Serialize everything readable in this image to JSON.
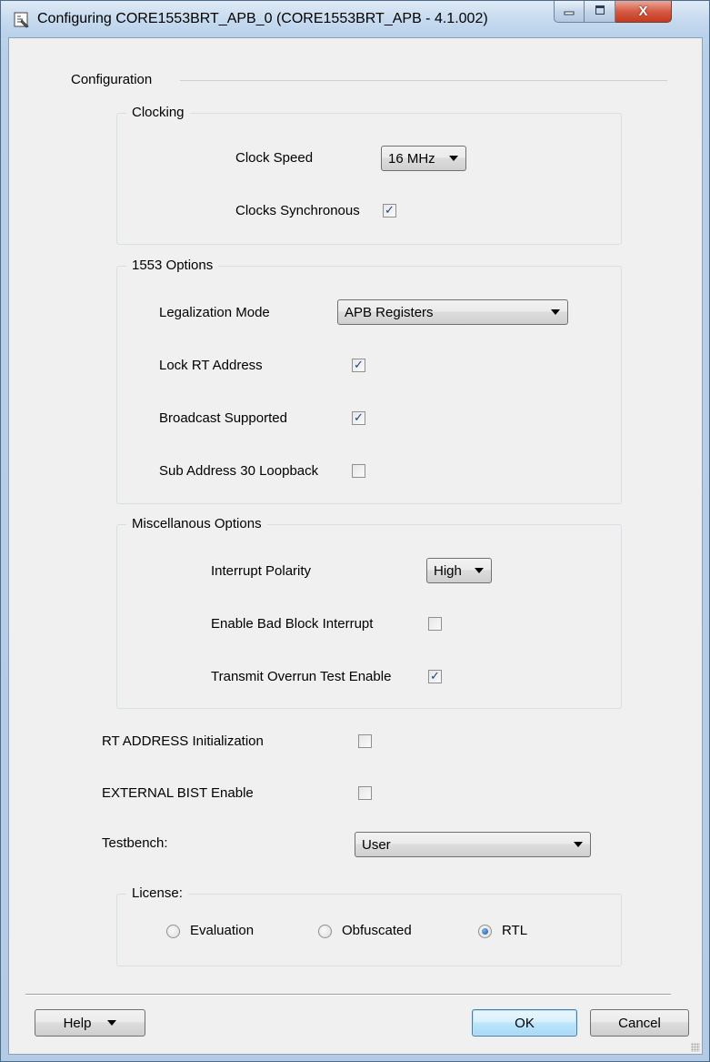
{
  "window": {
    "title": "Configuring CORE1553BRT_APB_0 (CORE1553BRT_APB - 4.1.002)",
    "close_glyph": "X",
    "icons": {
      "app": "config-app-icon",
      "minimize": "minimize-icon",
      "maximize": "maximize-icon",
      "close": "close-icon"
    },
    "accent_close_color": "#c33a1f"
  },
  "configuration": {
    "section_label": "Configuration",
    "clocking": {
      "label": "Clocking",
      "clock_speed_label": "Clock Speed",
      "clock_speed_value": "16 MHz",
      "clocks_synchronous_label": "Clocks Synchronous",
      "clocks_synchronous_checked": true
    },
    "options_1553": {
      "label": "1553 Options",
      "legalization_mode_label": "Legalization Mode",
      "legalization_mode_value": "APB Registers",
      "lock_rt_address_label": "Lock RT Address",
      "lock_rt_address_checked": true,
      "broadcast_supported_label": "Broadcast Supported",
      "broadcast_supported_checked": true,
      "sub_address_30_loopback_label": "Sub Address 30 Loopback",
      "sub_address_30_loopback_checked": false
    },
    "misc": {
      "label": "Miscellanous Options",
      "interrupt_polarity_label": "Interrupt Polarity",
      "interrupt_polarity_value": "High",
      "enable_bad_block_interrupt_label": "Enable Bad Block Interrupt",
      "enable_bad_block_interrupt_checked": false,
      "transmit_overrun_test_enable_label": "Transmit Overrun Test Enable",
      "transmit_overrun_test_enable_checked": true
    },
    "rt_address_initialization_label": "RT ADDRESS Initialization",
    "rt_address_initialization_checked": false,
    "external_bist_enable_label": "EXTERNAL BIST Enable",
    "external_bist_enable_checked": false,
    "testbench_label": "Testbench:",
    "testbench_value": "User",
    "license": {
      "label": "License:",
      "options": [
        "Evaluation",
        "Obfuscated",
        "RTL"
      ],
      "selected": "RTL"
    }
  },
  "footer": {
    "help_label": "Help",
    "ok_label": "OK",
    "cancel_label": "Cancel"
  },
  "check_glyph": "✓"
}
